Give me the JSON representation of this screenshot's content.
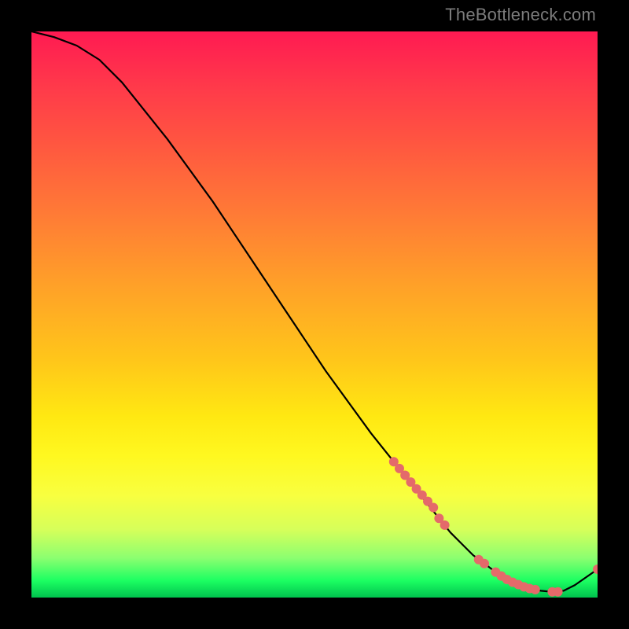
{
  "watermark": "TheBottleneck.com",
  "chart_data": {
    "type": "line",
    "title": "",
    "xlabel": "",
    "ylabel": "",
    "xlim": [
      0,
      100
    ],
    "ylim": [
      0,
      100
    ],
    "grid": false,
    "series": [
      {
        "name": "bottleneck-curve",
        "x": [
          0,
          4,
          8,
          12,
          16,
          20,
          24,
          28,
          32,
          36,
          40,
          44,
          48,
          52,
          56,
          60,
          64,
          68,
          72,
          74,
          76,
          78,
          80,
          82,
          84,
          86,
          88,
          90,
          92,
          94,
          96,
          100
        ],
        "y": [
          100,
          99,
          97.5,
          95,
          91,
          86,
          81,
          75.5,
          70,
          64,
          58,
          52,
          46,
          40,
          34.5,
          29,
          24,
          19,
          14,
          11.5,
          9.5,
          7.5,
          6,
          4.5,
          3.2,
          2.3,
          1.6,
          1.2,
          1.0,
          1.2,
          2.2,
          5
        ]
      }
    ],
    "markers": {
      "name": "highlight-points",
      "color": "#e46a6a",
      "radius_px": 6,
      "x": [
        64,
        65,
        66,
        67,
        68,
        69,
        70,
        71,
        72,
        73,
        79,
        80,
        82,
        83,
        84,
        85,
        86,
        87,
        88,
        89,
        92,
        93,
        100
      ],
      "y": [
        24,
        22.8,
        21.6,
        20.4,
        19.2,
        18.1,
        17.0,
        15.9,
        14.0,
        12.8,
        6.7,
        6.0,
        4.5,
        3.8,
        3.2,
        2.7,
        2.3,
        1.9,
        1.6,
        1.4,
        1.0,
        1.0,
        5.0
      ]
    },
    "background_gradient": {
      "description": "vertical heat gradient, red top to green bottom",
      "stops": [
        {
          "pos": 0.0,
          "hex": "#ff1a52"
        },
        {
          "pos": 0.1,
          "hex": "#ff3a4a"
        },
        {
          "pos": 0.2,
          "hex": "#ff5740"
        },
        {
          "pos": 0.32,
          "hex": "#ff7a36"
        },
        {
          "pos": 0.45,
          "hex": "#ffa128"
        },
        {
          "pos": 0.58,
          "hex": "#ffc61a"
        },
        {
          "pos": 0.68,
          "hex": "#ffe812"
        },
        {
          "pos": 0.75,
          "hex": "#fff820"
        },
        {
          "pos": 0.82,
          "hex": "#f8ff40"
        },
        {
          "pos": 0.88,
          "hex": "#d6ff5a"
        },
        {
          "pos": 0.93,
          "hex": "#8cff70"
        },
        {
          "pos": 0.97,
          "hex": "#1cff62"
        },
        {
          "pos": 1.0,
          "hex": "#00c24e"
        }
      ]
    }
  }
}
